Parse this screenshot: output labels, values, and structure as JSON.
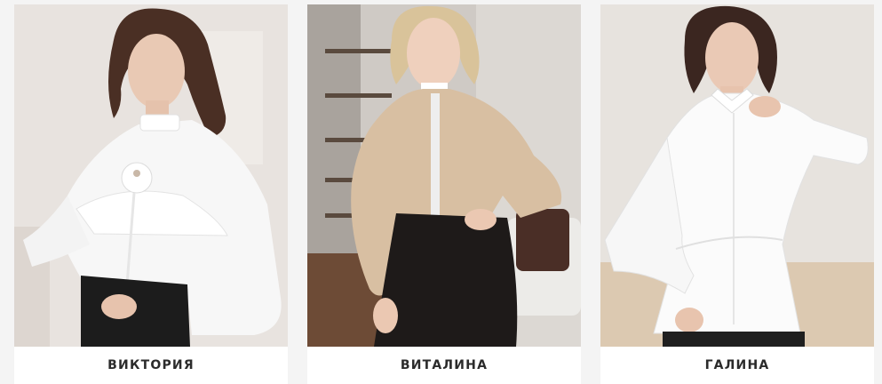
{
  "products": [
    {
      "name": "ВИКТОРИЯ",
      "image": "woman-white-blouse-photo"
    },
    {
      "name": "ВИТАЛИНА",
      "image": "woman-beige-blouse-photo"
    },
    {
      "name": "ГАЛИНА",
      "image": "woman-white-shirt-photo"
    }
  ]
}
